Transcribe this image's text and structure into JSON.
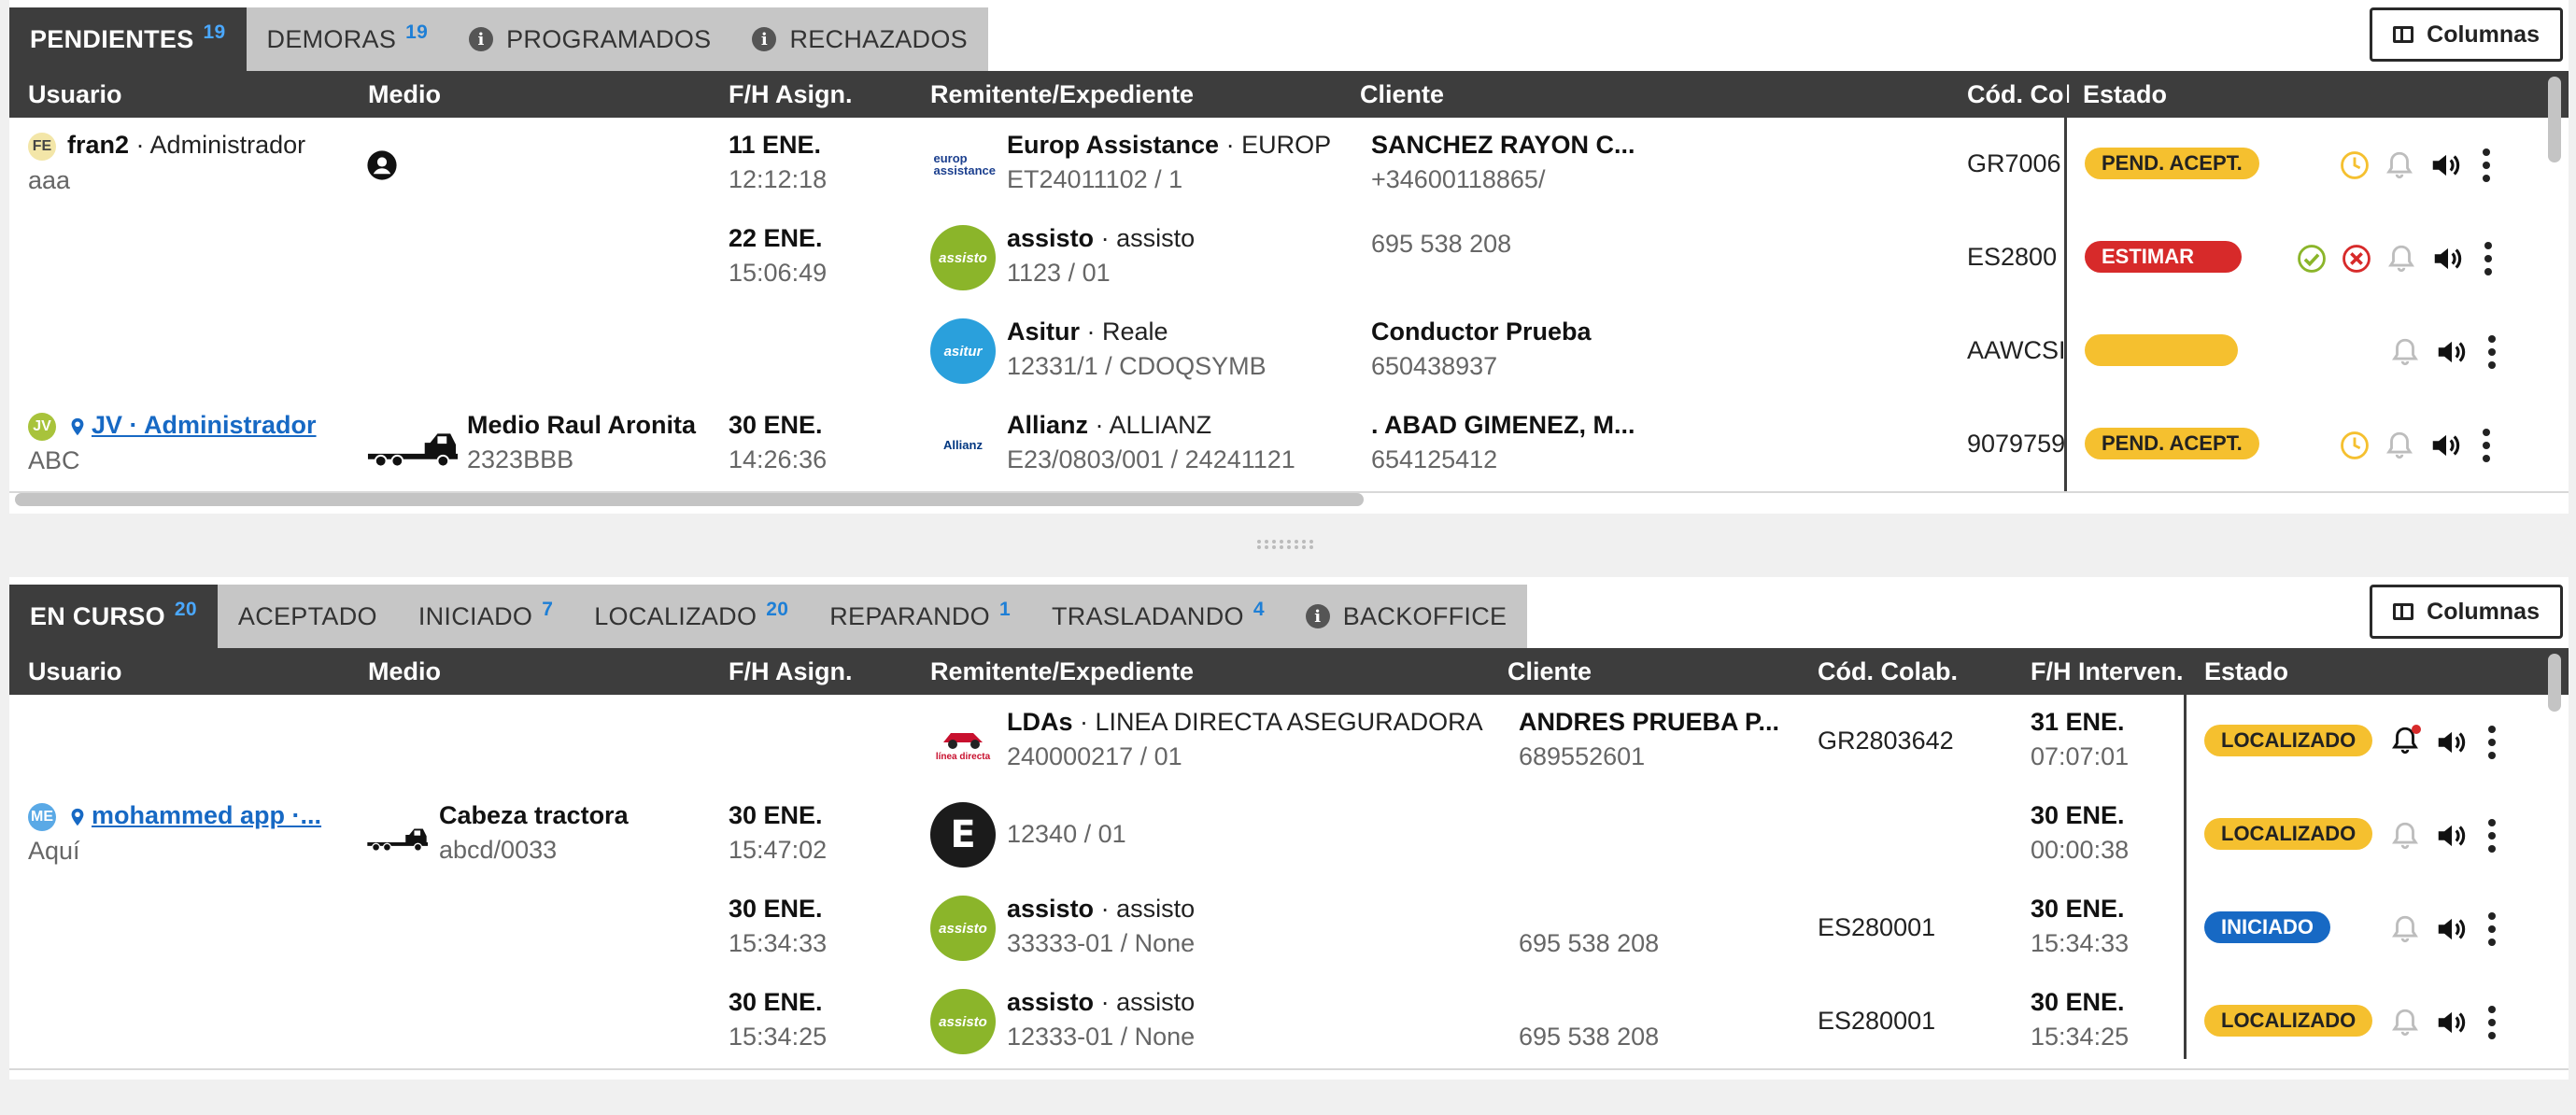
{
  "top": {
    "tabs": [
      {
        "label": "PENDIENTES",
        "count": "19"
      },
      {
        "label": "DEMORAS",
        "count": "19"
      },
      {
        "label": "PROGRAMADOS",
        "count": ""
      },
      {
        "label": "RECHAZADOS",
        "count": ""
      }
    ],
    "columns_button": "Columnas",
    "headers": {
      "user": "Usuario",
      "medio": "Medio",
      "fh": "F/H Asign.",
      "rem": "Remitente/Expediente",
      "cliente": "Cliente",
      "cod": "Cód. Col",
      "estado": "Estado"
    },
    "rows": [
      {
        "avatar": "FE",
        "user": "fran2",
        "role": "· Administrador",
        "user2": "aaa",
        "medio": "",
        "medio2": "",
        "date": "11 ENE.",
        "time": "12:12:18",
        "logo": "europ assistance",
        "rem": "Europ Assistance",
        "rem_tag": "· EUROP",
        "exp": "ET24011102 / 1",
        "cliente": "SANCHEZ RAYON C...",
        "cliente2": "+34600118865/",
        "cod": "GR7006",
        "estado": "PEND. ACEPT."
      },
      {
        "avatar": "",
        "user": "",
        "role": "",
        "user2": "",
        "medio": "",
        "medio2": "",
        "date": "22 ENE.",
        "time": "15:06:49",
        "logo": "assisto",
        "rem": "assisto",
        "rem_tag": "· assisto",
        "exp": "1123 / 01",
        "cliente": "",
        "cliente2": "695 538 208",
        "cod": "ES2800",
        "estado": "ESTIMAR"
      },
      {
        "avatar": "",
        "user": "",
        "role": "",
        "user2": "",
        "medio": "",
        "medio2": "",
        "date": "",
        "time": "",
        "logo": "asitur",
        "rem": "Asitur",
        "rem_tag": "· Reale",
        "exp": "12331/1 / CDOQSYMB",
        "cliente": "Conductor Prueba",
        "cliente2": "650438937",
        "cod": "AAWCSI",
        "estado": ""
      },
      {
        "avatar": "JV",
        "user": "JV · Administrador",
        "role": "",
        "user2": "ABC",
        "medio": "Medio Raul Aronita",
        "medio2": "2323BBB",
        "date": "30 ENE.",
        "time": "14:26:36",
        "logo": "Allianz",
        "rem": "Allianz",
        "rem_tag": "· ALLIANZ",
        "exp": "E23/0803/001 / 24241121",
        "cliente": ". ABAD GIMENEZ, M...",
        "cliente2": "654125412",
        "cod": "9079759",
        "estado": "PEND. ACEPT."
      }
    ]
  },
  "bottom": {
    "tabs": [
      {
        "label": "EN CURSO",
        "count": "20"
      },
      {
        "label": "ACEPTADO",
        "count": ""
      },
      {
        "label": "INICIADO",
        "count": "7"
      },
      {
        "label": "LOCALIZADO",
        "count": "20"
      },
      {
        "label": "REPARANDO",
        "count": "1"
      },
      {
        "label": "TRASLADANDO",
        "count": "4"
      },
      {
        "label": "BACKOFFICE",
        "count": ""
      }
    ],
    "columns_button": "Columnas",
    "headers": {
      "user": "Usuario",
      "medio": "Medio",
      "fh": "F/H Asign.",
      "rem": "Remitente/Expediente",
      "cliente": "Cliente",
      "cod": "Cód. Colab.",
      "fhi": "F/H Interven.",
      "estado": "Estado"
    },
    "rows": [
      {
        "avatar": "",
        "user": "",
        "user2": "",
        "medio": "",
        "medio2": "",
        "date": "",
        "time": "",
        "logo": "línea directa",
        "rem": "LDAs",
        "rem_tag": "· LINEA DIRECTA ASEGURADORA",
        "exp": "240000217 / 01",
        "cliente": "ANDRES PRUEBA P...",
        "cliente2": "689552601",
        "cod": "GR2803642",
        "idate": "31 ENE.",
        "itime": "07:07:01",
        "estado": "LOCALIZADO"
      },
      {
        "avatar": "ME",
        "user": "mohammed app ·...",
        "user2": "Aquí",
        "medio": "Cabeza tractora",
        "medio2": "abcd/0033",
        "date": "30 ENE.",
        "time": "15:47:02",
        "logo": "E",
        "rem": "",
        "rem_tag": "",
        "exp": "12340 / 01",
        "cliente": "",
        "cliente2": "",
        "cod": "",
        "idate": "30 ENE.",
        "itime": "00:00:38",
        "estado": "LOCALIZADO"
      },
      {
        "avatar": "",
        "user": "",
        "user2": "",
        "medio": "",
        "medio2": "",
        "date": "30 ENE.",
        "time": "15:34:33",
        "logo": "assisto",
        "rem": "assisto",
        "rem_tag": "· assisto",
        "exp": "33333-01 / None",
        "cliente": "",
        "cliente2": "695 538 208",
        "cod": "ES280001",
        "idate": "30 ENE.",
        "itime": "15:34:33",
        "estado": "INICIADO"
      },
      {
        "avatar": "",
        "user": "",
        "user2": "",
        "medio": "",
        "medio2": "",
        "date": "30 ENE.",
        "time": "15:34:25",
        "logo": "assisto",
        "rem": "assisto",
        "rem_tag": "· assisto",
        "exp": "12333-01 / None",
        "cliente": "",
        "cliente2": "695 538 208",
        "cod": "ES280001",
        "idate": "30 ENE.",
        "itime": "15:34:25",
        "estado": "LOCALIZADO"
      }
    ]
  },
  "icons": [
    "clock-icon",
    "bell-icon",
    "speaker-icon",
    "kebab-icon",
    "check-icon",
    "cancel-icon",
    "user-icon",
    "location-pin-icon",
    "truck-icon",
    "info-icon",
    "columns-icon"
  ],
  "colors": {
    "accent": "#1e7fd6",
    "header": "#3d3d3d",
    "pending": "#f5c02f",
    "estimate": "#d72a2a",
    "started": "#1769c4"
  }
}
